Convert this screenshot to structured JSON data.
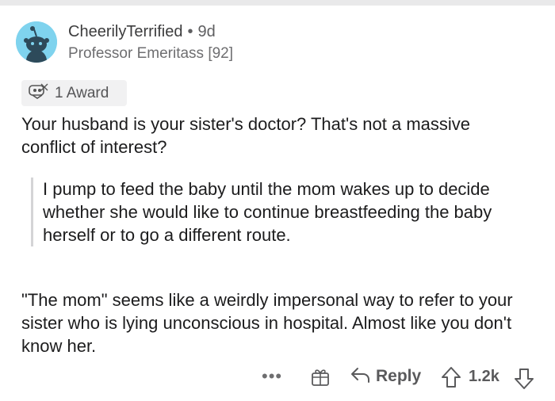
{
  "comment": {
    "author": "CheerilyTerrified",
    "separator": "•",
    "age": "9d",
    "flair": "Professor Emeritass [92]",
    "award_label": "1 Award",
    "paragraph_1": "Your husband is your sister's doctor? That's not a massive conflict of interest?",
    "quote": "I pump to feed the baby until the mom wakes up to decide whether she would like to continue breastfeeding the baby herself or to go a different route.",
    "paragraph_2": "\"The mom\" seems like a weirdly impersonal way to refer to your sister who is lying unconscious in hospital. Almost like you don't know her."
  },
  "actions": {
    "more": "•••",
    "reply_label": "Reply",
    "score": "1.2k"
  },
  "colors": {
    "avatar_bg": "#7fd3ee",
    "text": "#1c1c1d",
    "meta": "#6e6e70"
  },
  "icons": [
    "snoo-avatar-icon",
    "award-icon",
    "more-icon",
    "gift-icon",
    "reply-arrow-icon",
    "upvote-icon",
    "downvote-icon"
  ]
}
